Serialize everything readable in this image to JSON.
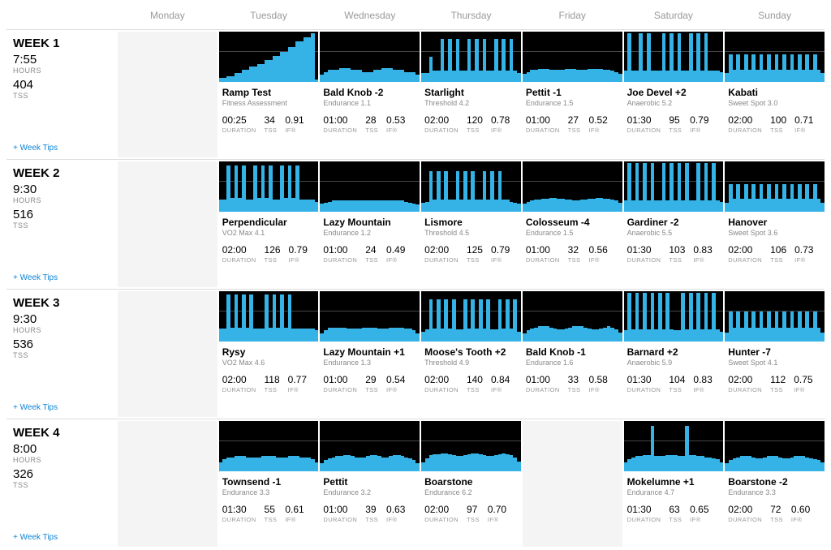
{
  "days": [
    "Monday",
    "Tuesday",
    "Wednesday",
    "Thursday",
    "Friday",
    "Saturday",
    "Sunday"
  ],
  "weekTipsLabel": "+ Week Tips",
  "statLabels": {
    "duration": "DURATION",
    "tss": "TSS",
    "if": "IF®"
  },
  "weekLabels": {
    "hours": "HOURS",
    "tss": "TSS"
  },
  "weeks": [
    {
      "title": "WEEK 1",
      "hours": "7:55",
      "tss": "404",
      "days": [
        null,
        {
          "name": "Ramp Test",
          "cat": "Fitness Assessment",
          "duration": "00:25",
          "tss": "34",
          "if": "0.91",
          "profile": [
            8,
            8,
            12,
            12,
            18,
            18,
            24,
            24,
            30,
            30,
            36,
            36,
            44,
            44,
            52,
            52,
            60,
            60,
            70,
            70,
            80,
            80,
            88,
            88,
            96,
            5
          ]
        },
        {
          "name": "Bald Knob -2",
          "cat": "Endurance 1.1",
          "duration": "01:00",
          "tss": "28",
          "if": "0.53",
          "profile": [
            15,
            20,
            24,
            24,
            24,
            28,
            28,
            28,
            24,
            24,
            24,
            20,
            20,
            20,
            24,
            24,
            28,
            28,
            28,
            24,
            24,
            24,
            20,
            20,
            20,
            15
          ]
        },
        {
          "name": "Starlight",
          "cat": "Threshold 4.2",
          "duration": "02:00",
          "tss": "120",
          "if": "0.78",
          "profile": [
            18,
            18,
            50,
            22,
            22,
            85,
            22,
            85,
            22,
            85,
            22,
            22,
            85,
            22,
            85,
            22,
            85,
            22,
            22,
            85,
            22,
            85,
            22,
            85,
            22,
            18
          ]
        },
        {
          "name": "Pettit -1",
          "cat": "Endurance 1.5",
          "duration": "01:00",
          "tss": "27",
          "if": "0.52",
          "profile": [
            16,
            20,
            24,
            24,
            26,
            26,
            26,
            24,
            24,
            24,
            24,
            26,
            26,
            26,
            24,
            24,
            24,
            26,
            26,
            26,
            26,
            24,
            24,
            22,
            20,
            16
          ]
        },
        {
          "name": "Joe Devel +2",
          "cat": "Anaerobic 5.2",
          "duration": "01:30",
          "tss": "95",
          "if": "0.79",
          "profile": [
            22,
            96,
            22,
            22,
            96,
            22,
            96,
            22,
            22,
            22,
            96,
            22,
            96,
            22,
            96,
            22,
            22,
            96,
            22,
            96,
            22,
            96,
            22,
            22,
            22,
            20
          ]
        },
        {
          "name": "Kabati",
          "cat": "Sweet Spot 3.0",
          "duration": "02:00",
          "tss": "100",
          "if": "0.71",
          "profile": [
            18,
            55,
            25,
            55,
            25,
            55,
            25,
            55,
            25,
            55,
            25,
            55,
            25,
            55,
            25,
            55,
            25,
            55,
            25,
            55,
            25,
            55,
            25,
            55,
            25,
            18
          ]
        }
      ]
    },
    {
      "title": "WEEK 2",
      "hours": "9:30",
      "tss": "516",
      "days": [
        null,
        {
          "name": "Perpendicular",
          "cat": "VO2 Max 4.1",
          "duration": "02:00",
          "tss": "126",
          "if": "0.79",
          "profile": [
            25,
            25,
            92,
            28,
            92,
            28,
            92,
            25,
            25,
            92,
            28,
            92,
            28,
            92,
            25,
            25,
            92,
            28,
            92,
            28,
            92,
            25,
            25,
            25,
            25,
            20
          ]
        },
        {
          "name": "Lazy Mountain",
          "cat": "Endurance 1.2",
          "duration": "01:00",
          "tss": "24",
          "if": "0.49",
          "profile": [
            16,
            18,
            20,
            22,
            22,
            22,
            22,
            22,
            22,
            22,
            22,
            22,
            22,
            22,
            22,
            22,
            22,
            22,
            22,
            22,
            22,
            22,
            20,
            18,
            16,
            14
          ]
        },
        {
          "name": "Lismore",
          "cat": "Threshold 4.5",
          "duration": "02:00",
          "tss": "125",
          "if": "0.79",
          "profile": [
            18,
            20,
            80,
            25,
            80,
            25,
            80,
            25,
            25,
            80,
            25,
            80,
            25,
            80,
            25,
            25,
            80,
            25,
            80,
            25,
            80,
            25,
            25,
            20,
            18,
            16
          ]
        },
        {
          "name": "Colosseum -4",
          "cat": "Endurance 1.5",
          "duration": "01:00",
          "tss": "32",
          "if": "0.56",
          "profile": [
            16,
            20,
            22,
            24,
            24,
            26,
            26,
            28,
            28,
            26,
            26,
            24,
            24,
            22,
            22,
            24,
            24,
            26,
            26,
            28,
            28,
            26,
            26,
            24,
            22,
            18
          ]
        },
        {
          "name": "Gardiner -2",
          "cat": "Anaerobic 5.5",
          "duration": "01:30",
          "tss": "103",
          "if": "0.83",
          "profile": [
            22,
            96,
            22,
            96,
            22,
            96,
            22,
            96,
            22,
            22,
            96,
            22,
            96,
            22,
            96,
            22,
            96,
            22,
            22,
            96,
            22,
            96,
            22,
            96,
            22,
            20
          ]
        },
        {
          "name": "Hanover",
          "cat": "Sweet Spot 3.6",
          "duration": "02:00",
          "tss": "106",
          "if": "0.73",
          "profile": [
            18,
            55,
            26,
            55,
            26,
            55,
            26,
            55,
            26,
            55,
            26,
            55,
            26,
            55,
            26,
            55,
            26,
            55,
            26,
            55,
            26,
            55,
            26,
            55,
            26,
            18
          ]
        }
      ]
    },
    {
      "title": "WEEK 3",
      "hours": "9:30",
      "tss": "536",
      "days": [
        null,
        {
          "name": "Rysy",
          "cat": "VO2 Max 4.6",
          "duration": "02:00",
          "tss": "118",
          "if": "0.77",
          "profile": [
            26,
            26,
            94,
            28,
            94,
            28,
            94,
            28,
            94,
            26,
            26,
            26,
            94,
            28,
            94,
            28,
            94,
            28,
            94,
            26,
            26,
            26,
            26,
            26,
            26,
            22
          ]
        },
        {
          "name": "Lazy Mountain +1",
          "cat": "Endurance 1.3",
          "duration": "01:00",
          "tss": "29",
          "if": "0.54",
          "profile": [
            16,
            22,
            28,
            28,
            28,
            28,
            28,
            26,
            26,
            26,
            26,
            28,
            28,
            28,
            28,
            26,
            26,
            26,
            28,
            28,
            28,
            28,
            26,
            26,
            22,
            16
          ]
        },
        {
          "name": "Moose's Tooth +2",
          "cat": "Threshold 4.9",
          "duration": "02:00",
          "tss": "140",
          "if": "0.84",
          "profile": [
            20,
            24,
            84,
            26,
            84,
            26,
            84,
            26,
            84,
            24,
            24,
            84,
            26,
            84,
            26,
            84,
            26,
            84,
            24,
            24,
            84,
            26,
            84,
            26,
            84,
            20
          ]
        },
        {
          "name": "Bald Knob -1",
          "cat": "Endurance 1.6",
          "duration": "01:00",
          "tss": "33",
          "if": "0.58",
          "profile": [
            16,
            22,
            26,
            28,
            30,
            30,
            30,
            28,
            26,
            24,
            24,
            26,
            28,
            30,
            30,
            30,
            28,
            26,
            24,
            24,
            26,
            28,
            30,
            28,
            24,
            18
          ]
        },
        {
          "name": "Barnard +2",
          "cat": "Anaerobic 5.9",
          "duration": "01:30",
          "tss": "104",
          "if": "0.83",
          "profile": [
            22,
            96,
            24,
            96,
            24,
            96,
            24,
            96,
            24,
            96,
            24,
            96,
            24,
            22,
            22,
            96,
            24,
            96,
            24,
            96,
            24,
            96,
            24,
            96,
            24,
            20
          ]
        },
        {
          "name": "Hunter -7",
          "cat": "Sweet Spot 4.1",
          "duration": "02:00",
          "tss": "112",
          "if": "0.75",
          "profile": [
            18,
            60,
            28,
            60,
            28,
            60,
            28,
            60,
            28,
            60,
            28,
            60,
            28,
            60,
            28,
            60,
            28,
            60,
            28,
            60,
            28,
            60,
            28,
            60,
            28,
            18
          ]
        }
      ]
    },
    {
      "title": "WEEK 4",
      "hours": "8:00",
      "tss": "326",
      "days": [
        null,
        {
          "name": "Townsend -1",
          "cat": "Endurance 3.3",
          "duration": "01:30",
          "tss": "55",
          "if": "0.61",
          "profile": [
            18,
            24,
            28,
            28,
            30,
            30,
            30,
            28,
            28,
            28,
            28,
            30,
            30,
            30,
            30,
            28,
            28,
            28,
            30,
            30,
            30,
            28,
            28,
            28,
            24,
            18
          ]
        },
        {
          "name": "Pettit",
          "cat": "Endurance 3.2",
          "duration": "01:00",
          "tss": "39",
          "if": "0.63",
          "profile": [
            16,
            22,
            26,
            28,
            30,
            30,
            32,
            32,
            30,
            28,
            28,
            28,
            30,
            32,
            32,
            30,
            28,
            28,
            30,
            32,
            32,
            30,
            28,
            26,
            22,
            16
          ]
        },
        {
          "name": "Boarstone",
          "cat": "Endurance 6.2",
          "duration": "02:00",
          "tss": "97",
          "if": "0.70",
          "profile": [
            18,
            26,
            32,
            34,
            34,
            36,
            36,
            34,
            32,
            30,
            30,
            32,
            34,
            36,
            36,
            34,
            32,
            30,
            30,
            32,
            34,
            36,
            34,
            32,
            28,
            20
          ]
        },
        null,
        {
          "name": "Mokelumne +1",
          "cat": "Endurance 4.7",
          "duration": "01:30",
          "tss": "63",
          "if": "0.65",
          "profile": [
            18,
            24,
            28,
            30,
            30,
            32,
            32,
            90,
            30,
            30,
            30,
            32,
            32,
            32,
            30,
            30,
            90,
            32,
            32,
            30,
            30,
            28,
            28,
            26,
            24,
            18
          ]
        },
        {
          "name": "Boarstone -2",
          "cat": "Endurance 3.3",
          "duration": "02:00",
          "tss": "72",
          "if": "0.60",
          "profile": [
            16,
            22,
            26,
            28,
            30,
            30,
            30,
            28,
            26,
            26,
            28,
            30,
            30,
            30,
            28,
            26,
            26,
            28,
            30,
            30,
            30,
            28,
            26,
            24,
            22,
            18
          ]
        }
      ]
    }
  ]
}
